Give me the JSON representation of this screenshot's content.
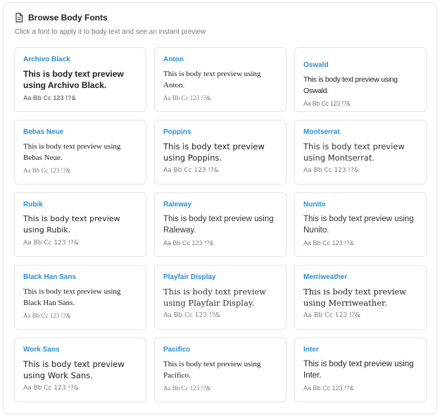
{
  "header": {
    "title": "Browse Body Fonts",
    "subtitle": "Click a font to apply it to body text and see an instant preview"
  },
  "sample_text": "Aa Bb Cc 123 !?&",
  "accent_color": "#2b8fd8",
  "fonts": [
    {
      "name": "Archivo Black",
      "preview": "This is body text preview using Archivo Black."
    },
    {
      "name": "Anton",
      "preview": "This is body text preview using Anton."
    },
    {
      "name": "Oswald",
      "preview": "This is body text preview using Oswald."
    },
    {
      "name": "Bebas Neue",
      "preview": "This is body text preview using Bebas Neue."
    },
    {
      "name": "Poppins",
      "preview": "This is body text preview using Poppins."
    },
    {
      "name": "Montserrat",
      "preview": "This is body text preview using Montserrat."
    },
    {
      "name": "Rubik",
      "preview": "This is body text preview using Rubik."
    },
    {
      "name": "Raleway",
      "preview": "This is body text preview using Raleway."
    },
    {
      "name": "Nunito",
      "preview": "This is body text preview using Nunito."
    },
    {
      "name": "Black Han Sans",
      "preview": "This is body text preview using Black Han Sans."
    },
    {
      "name": "Playfair Display",
      "preview": "This is body text preview using Playfair Display."
    },
    {
      "name": "Merriweather",
      "preview": "This is body text preview using Merriweather."
    },
    {
      "name": "Work Sans",
      "preview": "This is body text preview using Work Sans."
    },
    {
      "name": "Pacifico",
      "preview": "This is body text preview using Pacifico."
    },
    {
      "name": "Inter",
      "preview": "This is body text preview using Inter."
    }
  ]
}
